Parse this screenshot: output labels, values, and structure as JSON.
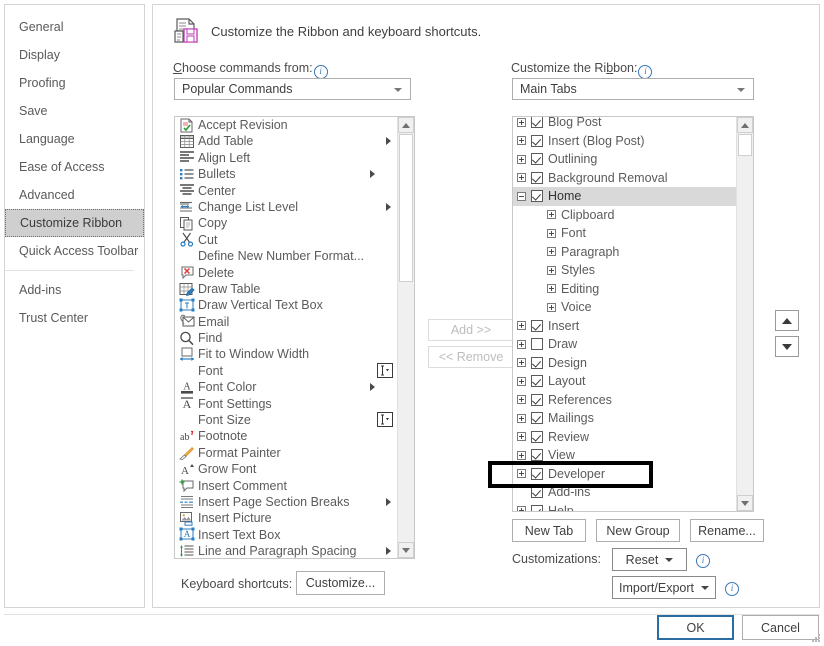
{
  "nav": {
    "items": [
      {
        "label": "General",
        "selected": false
      },
      {
        "label": "Display",
        "selected": false
      },
      {
        "label": "Proofing",
        "selected": false
      },
      {
        "label": "Save",
        "selected": false
      },
      {
        "label": "Language",
        "selected": false
      },
      {
        "label": "Ease of Access",
        "selected": false
      },
      {
        "label": "Advanced",
        "selected": false
      },
      {
        "label": "Customize Ribbon",
        "selected": true
      },
      {
        "label": "Quick Access Toolbar",
        "selected": false
      },
      {
        "label": "Add-ins",
        "selected": false
      },
      {
        "label": "Trust Center",
        "selected": false
      }
    ]
  },
  "header": {
    "title": "Customize the Ribbon and keyboard shortcuts.",
    "icon": "customize-ribbon-icon"
  },
  "left_panel": {
    "label_prefix": "C",
    "label_rest": "hoose commands from:",
    "info_icon": "info-icon",
    "dropdown_value": "Popular Commands",
    "commands": [
      {
        "label": "Accept Revision",
        "icon": "accept-revision-icon",
        "submenu": false,
        "combo": false
      },
      {
        "label": "Add Table",
        "icon": "add-table-icon",
        "submenu": true,
        "combo": false
      },
      {
        "label": "Align Left",
        "icon": "align-left-icon",
        "submenu": false,
        "combo": false
      },
      {
        "label": "Bullets",
        "icon": "bullets-icon",
        "submenu": true,
        "submenu_near": true,
        "combo": false
      },
      {
        "label": "Center",
        "icon": "center-icon",
        "submenu": false,
        "combo": false
      },
      {
        "label": "Change List Level",
        "icon": "change-list-level-icon",
        "submenu": true,
        "combo": false
      },
      {
        "label": "Copy",
        "icon": "copy-icon",
        "submenu": false,
        "combo": false
      },
      {
        "label": "Cut",
        "icon": "cut-icon",
        "submenu": false,
        "combo": false
      },
      {
        "label": "Define New Number Format...",
        "icon": "none",
        "submenu": false,
        "combo": false
      },
      {
        "label": "Delete",
        "icon": "delete-icon",
        "submenu": false,
        "combo": false
      },
      {
        "label": "Draw Table",
        "icon": "draw-table-icon",
        "submenu": false,
        "combo": false
      },
      {
        "label": "Draw Vertical Text Box",
        "icon": "draw-vertical-text-box-icon",
        "submenu": false,
        "combo": false
      },
      {
        "label": "Email",
        "icon": "email-icon",
        "submenu": false,
        "combo": false
      },
      {
        "label": "Find",
        "icon": "find-icon",
        "submenu": false,
        "combo": false
      },
      {
        "label": "Fit to Window Width",
        "icon": "fit-to-window-width-icon",
        "submenu": false,
        "combo": false
      },
      {
        "label": "Font",
        "icon": "none",
        "submenu": false,
        "combo": true
      },
      {
        "label": "Font Color",
        "icon": "font-color-icon",
        "submenu": true,
        "submenu_near": true,
        "combo": false
      },
      {
        "label": "Font Settings",
        "icon": "font-settings-icon",
        "submenu": false,
        "combo": false
      },
      {
        "label": "Font Size",
        "icon": "none",
        "submenu": false,
        "combo": true
      },
      {
        "label": "Footnote",
        "icon": "footnote-icon",
        "submenu": false,
        "combo": false
      },
      {
        "label": "Format Painter",
        "icon": "format-painter-icon",
        "submenu": false,
        "combo": false
      },
      {
        "label": "Grow Font",
        "icon": "grow-font-icon",
        "submenu": false,
        "combo": false
      },
      {
        "label": "Insert Comment",
        "icon": "insert-comment-icon",
        "submenu": false,
        "combo": false
      },
      {
        "label": "Insert Page  Section Breaks",
        "icon": "insert-breaks-icon",
        "submenu": true,
        "combo": false
      },
      {
        "label": "Insert Picture",
        "icon": "insert-picture-icon",
        "submenu": false,
        "combo": false
      },
      {
        "label": "Insert Text Box",
        "icon": "insert-text-box-icon",
        "submenu": false,
        "combo": false
      },
      {
        "label": "Line and Paragraph Spacing",
        "icon": "line-paragraph-spacing-icon",
        "submenu": true,
        "combo": false
      }
    ]
  },
  "middle": {
    "add_label": "Add >>",
    "remove_label": "<< Remove",
    "add_enabled": false,
    "remove_enabled": false
  },
  "right_panel": {
    "label_prefix": "Customize the Ri",
    "label_key": "b",
    "label_suffix": "bon:",
    "info_icon": "info-icon",
    "dropdown_value": "Main Tabs",
    "tree": [
      {
        "label": "Blog Post",
        "level": 0,
        "expander": "plus",
        "checkbox": "checked",
        "selected": false,
        "clipped": true
      },
      {
        "label": "Insert (Blog Post)",
        "level": 0,
        "expander": "plus",
        "checkbox": "checked",
        "selected": false
      },
      {
        "label": "Outlining",
        "level": 0,
        "expander": "plus",
        "checkbox": "checked",
        "selected": false
      },
      {
        "label": "Background Removal",
        "level": 0,
        "expander": "plus",
        "checkbox": "checked",
        "selected": false
      },
      {
        "label": "Home",
        "level": 0,
        "expander": "minus",
        "checkbox": "checked",
        "selected": true
      },
      {
        "label": "Clipboard",
        "level": 1,
        "expander": "plus",
        "checkbox": "none",
        "selected": false
      },
      {
        "label": "Font",
        "level": 1,
        "expander": "plus",
        "checkbox": "none",
        "selected": false
      },
      {
        "label": "Paragraph",
        "level": 1,
        "expander": "plus",
        "checkbox": "none",
        "selected": false
      },
      {
        "label": "Styles",
        "level": 1,
        "expander": "plus",
        "checkbox": "none",
        "selected": false
      },
      {
        "label": "Editing",
        "level": 1,
        "expander": "plus",
        "checkbox": "none",
        "selected": false
      },
      {
        "label": "Voice",
        "level": 1,
        "expander": "plus",
        "checkbox": "none",
        "selected": false
      },
      {
        "label": "Insert",
        "level": 0,
        "expander": "plus",
        "checkbox": "checked",
        "selected": false
      },
      {
        "label": "Draw",
        "level": 0,
        "expander": "plus",
        "checkbox": "unchecked",
        "selected": false
      },
      {
        "label": "Design",
        "level": 0,
        "expander": "plus",
        "checkbox": "checked",
        "selected": false
      },
      {
        "label": "Layout",
        "level": 0,
        "expander": "plus",
        "checkbox": "checked",
        "selected": false
      },
      {
        "label": "References",
        "level": 0,
        "expander": "plus",
        "checkbox": "checked",
        "selected": false
      },
      {
        "label": "Mailings",
        "level": 0,
        "expander": "plus",
        "checkbox": "checked",
        "selected": false
      },
      {
        "label": "Review",
        "level": 0,
        "expander": "plus",
        "checkbox": "checked",
        "selected": false
      },
      {
        "label": "View",
        "level": 0,
        "expander": "plus",
        "checkbox": "checked",
        "selected": false
      },
      {
        "label": "Developer",
        "level": 0,
        "expander": "plus",
        "checkbox": "checked",
        "selected": false,
        "highlighted": true
      },
      {
        "label": "Add-ins",
        "level": 0,
        "expander": "none",
        "checkbox": "checked",
        "selected": false
      },
      {
        "label": "Help",
        "level": 0,
        "expander": "plus",
        "checkbox": "checked",
        "selected": false
      }
    ],
    "buttons": {
      "new_tab": "New Tab",
      "new_group": "New Group",
      "rename": "Rename...",
      "customizations_label": "Customizations:",
      "reset": "Reset",
      "import_export": "Import/Export"
    },
    "move_up_icon": "move-up-arrow-icon",
    "move_down_icon": "move-down-arrow-icon"
  },
  "footer": {
    "keyboard_shortcuts_label": "Keyboard shortcuts:",
    "customize_button": "Customize...",
    "ok": "OK",
    "cancel": "Cancel"
  },
  "colors": {
    "accent": "#2b6ca3",
    "selection": "#d9d9d9",
    "nav_selected": "#cfcfcf",
    "highlight_annotation": "#000000"
  }
}
